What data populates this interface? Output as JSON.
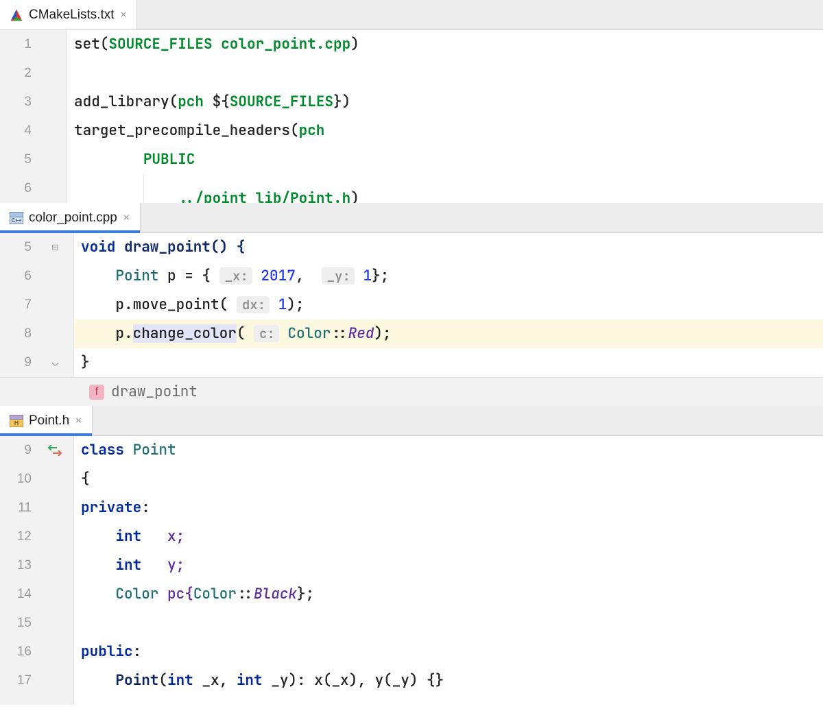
{
  "panes": [
    {
      "tab": {
        "filename": "CMakeLists.txt",
        "icon": "cmake"
      },
      "line_numbers": [
        "1",
        "2",
        "3",
        "4",
        "5",
        "6"
      ],
      "code": {
        "l1_set": "set(",
        "l1_arg1": "SOURCE_FILES",
        "l1_arg2": " color_point.cpp",
        "l1_close": ")",
        "l3_add": "add_library(",
        "l3_pch": "pch",
        "l3_var": " ${",
        "l3_varname": "SOURCE_FILES",
        "l3_end": "})",
        "l4_tph": "target_precompile_headers(",
        "l4_pch": "pch",
        "l5_pub": "PUBLIC",
        "l6_path": "../point_lib/Point.h",
        "l6_close": ")"
      }
    },
    {
      "tab": {
        "filename": "color_point.cpp",
        "icon": "cpp"
      },
      "line_numbers": [
        "5",
        "6",
        "7",
        "8",
        "9"
      ],
      "code": {
        "l5_void": "void",
        "l5_fn": " draw_point() {",
        "l6_type": "Point",
        "l6_pname": " p ",
        "l6_eq": "= { ",
        "hint_x": "_x:",
        "l6_v1": " 2017",
        "l6_comma": ",  ",
        "hint_y": "_y:",
        "l6_v2": " 1",
        "l6_end": "};",
        "l7_pre": "p.move_point( ",
        "hint_dx": "dx:",
        "l7_v": " 1",
        "l7_end": ");",
        "l8_p": "p.",
        "l8_fn": "change_color",
        "l8_open": "( ",
        "hint_c": "c:",
        "l8_space": " ",
        "l8_color": "Color",
        "l8_cc": "::",
        "l8_red": "Red",
        "l8_end": ");",
        "l9_close": "}"
      },
      "breadcrumb": {
        "badge": "f",
        "label": "draw_point"
      }
    },
    {
      "tab": {
        "filename": "Point.h",
        "icon": "h"
      },
      "line_numbers": [
        "9",
        "10",
        "11",
        "12",
        "13",
        "14",
        "15",
        "16",
        "17"
      ],
      "code": {
        "l9_class": "class",
        "l9_name": " Point",
        "l10_brace": "{",
        "l11_private": "private",
        "l11_colon": ":",
        "l12_int": "int",
        "l12_x": "   x;",
        "l13_int": "int",
        "l13_y": "   y;",
        "l14_color": "Color",
        "l14_pc": " pc{",
        "l14_color2": "Color",
        "l14_cc": "::",
        "l14_black": "Black",
        "l14_end": "};",
        "l16_public": "public",
        "l16_colon": ":",
        "l17_ctor": "Point",
        "l17_open": "(",
        "l17_int1": "int",
        "l17_a1": " _x, ",
        "l17_int2": "int",
        "l17_a2": " _y): x(_x), y(_y) {}"
      }
    }
  ]
}
